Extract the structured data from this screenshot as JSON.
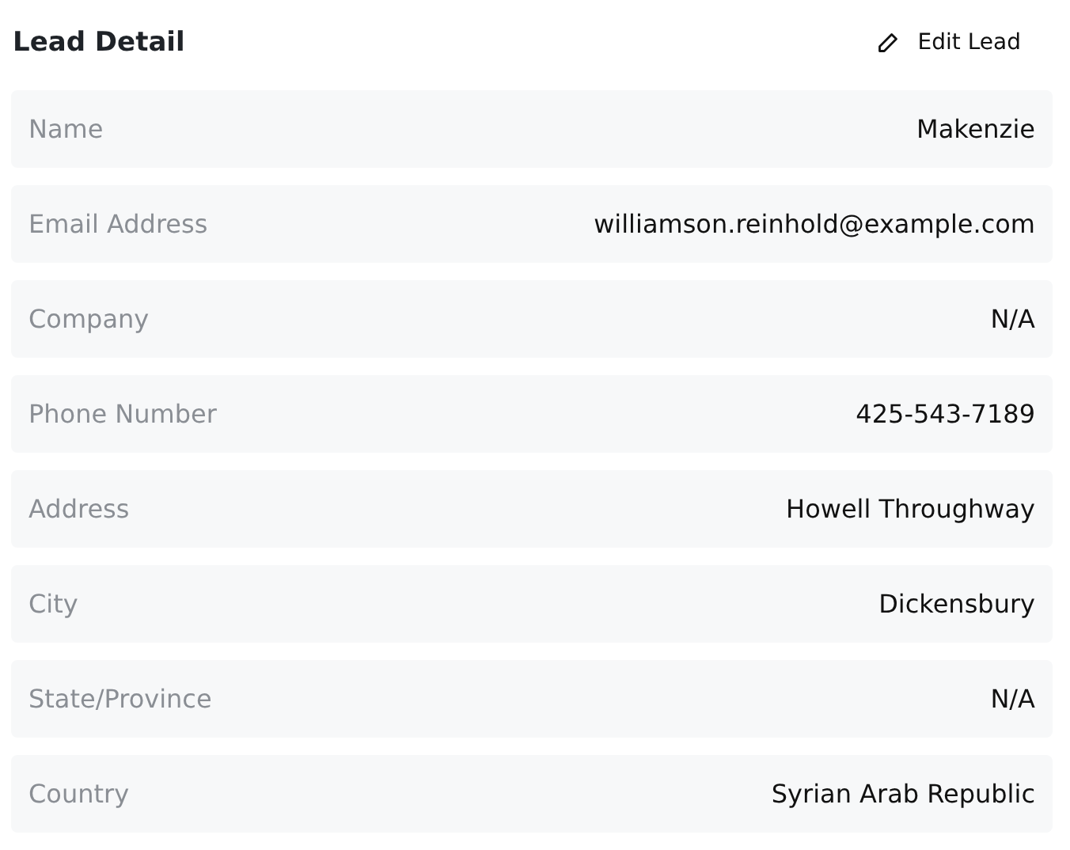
{
  "title": "Lead Detail",
  "edit_button": {
    "label": "Edit Lead"
  },
  "fields": [
    {
      "label": "Name",
      "value": "Makenzie"
    },
    {
      "label": "Email Address",
      "value": "williamson.reinhold@example.com"
    },
    {
      "label": "Company",
      "value": "N/A"
    },
    {
      "label": "Phone Number",
      "value": "425-543-7189"
    },
    {
      "label": "Address",
      "value": "Howell Throughway"
    },
    {
      "label": "City",
      "value": "Dickensbury"
    },
    {
      "label": "State/Province",
      "value": "N/A"
    },
    {
      "label": "Country",
      "value": "Syrian Arab Republic"
    }
  ]
}
